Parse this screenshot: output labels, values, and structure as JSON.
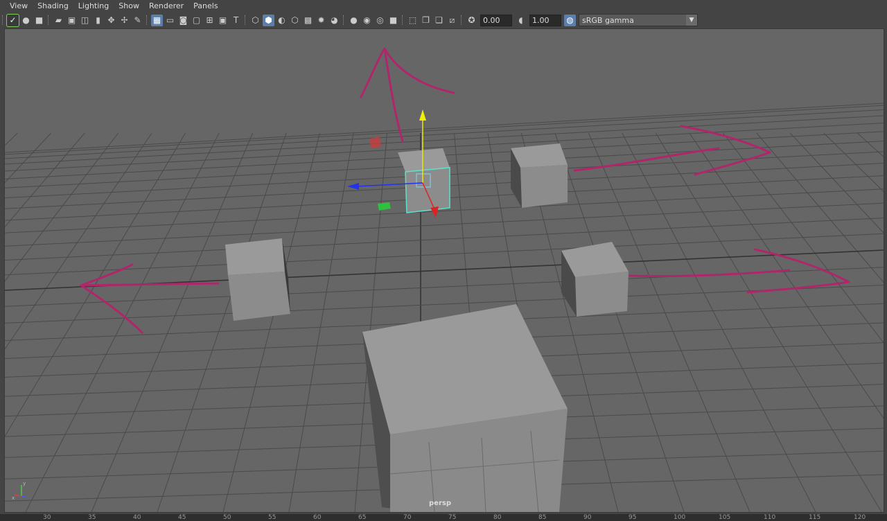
{
  "menubar": {
    "items": [
      "View",
      "Shading",
      "Lighting",
      "Show",
      "Renderer",
      "Panels"
    ]
  },
  "toolbar": {
    "exposure_value": "0.00",
    "gamma_value": "1.00",
    "color_space": "sRGB gamma"
  },
  "viewport": {
    "camera_label": "persp",
    "background_color": "#666666",
    "grid_color": "#4a4a4a",
    "annotation_color": "#b0266a",
    "selection_color": "#5fe0c8"
  },
  "axis_gizmo": {
    "x_label": "x",
    "y_label": "y"
  },
  "ruler": {
    "labels": [
      "30",
      "35",
      "40",
      "45",
      "50",
      "55",
      "60",
      "65",
      "70",
      "75",
      "80",
      "85",
      "90",
      "95",
      "100",
      "105",
      "110",
      "115",
      "120"
    ]
  }
}
